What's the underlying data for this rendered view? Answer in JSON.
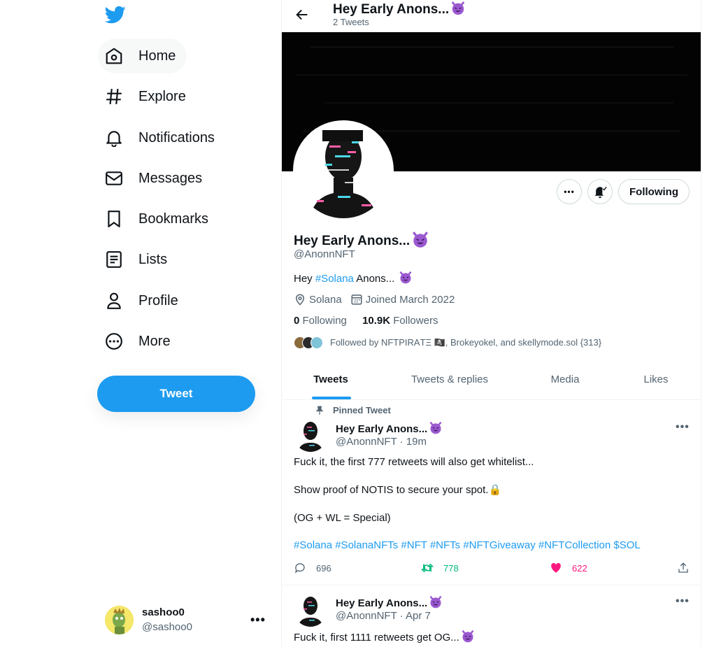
{
  "nav": {
    "items": [
      {
        "label": "Home",
        "icon": "home-icon"
      },
      {
        "label": "Explore",
        "icon": "hashtag-icon"
      },
      {
        "label": "Notifications",
        "icon": "bell-icon"
      },
      {
        "label": "Messages",
        "icon": "envelope-icon"
      },
      {
        "label": "Bookmarks",
        "icon": "bookmark-icon"
      },
      {
        "label": "Lists",
        "icon": "list-icon"
      },
      {
        "label": "Profile",
        "icon": "person-icon"
      },
      {
        "label": "More",
        "icon": "more-circle-icon"
      }
    ],
    "tweet_button": "Tweet",
    "account": {
      "name": "sashoo0",
      "handle": "@sashoo0"
    }
  },
  "header": {
    "title": "Hey Early Anons...",
    "tweet_count": "2 Tweets"
  },
  "profile": {
    "name": "Hey Early Anons...",
    "handle": "@AnonnNFT",
    "bio_prefix": "Hey ",
    "bio_hashtag": "#Solana",
    "bio_suffix": " Anons... ",
    "location": "Solana",
    "joined": "Joined March 2022",
    "following_count": "0",
    "following_label": "Following",
    "followers_count": "10.9K",
    "followers_label": "Followers",
    "followed_by": "Followed by NFTPIRAΤΞ 🏴‍☠️, Brokeyokel, and skellymode.sol {313}",
    "following_button": "Following"
  },
  "tabs": [
    "Tweets",
    "Tweets & replies",
    "Media",
    "Likes"
  ],
  "colors": {
    "accent": "#1d9bf0",
    "retweet": "#00ba7c",
    "like": "#f91880"
  },
  "tweets": [
    {
      "pinned_label": "Pinned Tweet",
      "name": "Hey Early Anons...",
      "handle_time": "@AnonnNFT · 19m",
      "text": "Fuck it, the first 777 retweets will also get whitelist...\n\nShow proof of NOTIS to secure your spot.🔒\n\n(OG + WL = Special)",
      "hashtags": "#Solana #SolanaNFTs #NFT #NFTs #NFTGiveaway #NFTCollection $SOL",
      "replies": "696",
      "retweets": "778",
      "likes": "622"
    },
    {
      "name": "Hey Early Anons...",
      "handle_time": "@AnonnNFT · Apr 7",
      "text": "Fuck it, first 1111 retweets get OG..."
    }
  ]
}
